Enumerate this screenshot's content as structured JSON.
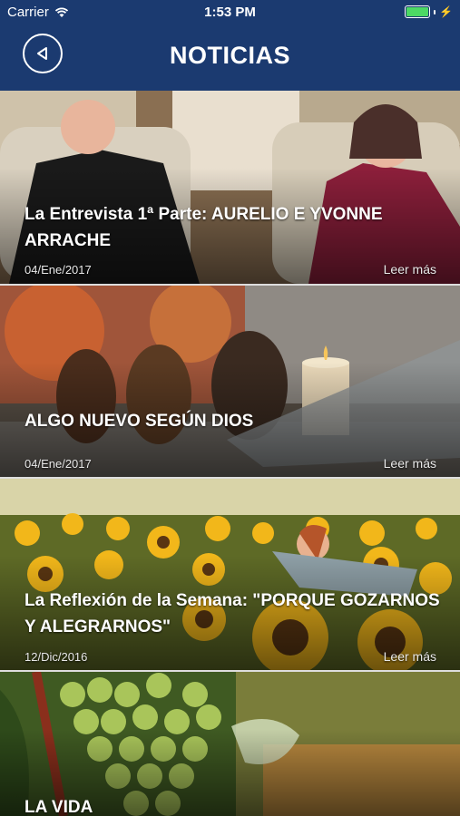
{
  "status_bar": {
    "carrier": "Carrier",
    "time": "1:53 PM"
  },
  "header": {
    "title": "NOTICIAS"
  },
  "articles": [
    {
      "title": "La Entrevista 1ª Parte: AURELIO E YVONNE ARRACHE",
      "date": "04/Ene/2017",
      "more": "Leer más"
    },
    {
      "title": "ALGO NUEVO SEGÚN DIOS",
      "date": "04/Ene/2017",
      "more": "Leer más"
    },
    {
      "title": "La Reflexión de la Semana: \"PORQUE GOZARNOS Y ALEGRARNOS\"",
      "date": "12/Dic/2016",
      "more": "Leer más"
    },
    {
      "title": "LA VIDA"
    }
  ]
}
